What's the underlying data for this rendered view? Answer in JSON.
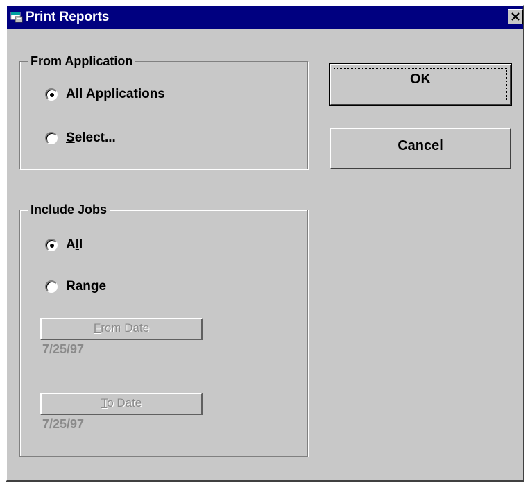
{
  "dialog": {
    "title": "Print Reports",
    "icon": "printer-window-icon",
    "close_icon": "close-x-icon"
  },
  "from_application": {
    "label": "From Application",
    "options": [
      {
        "first": "A",
        "rest": "ll Applications",
        "selected": true
      },
      {
        "first": "S",
        "rest": "elect...",
        "selected": false
      }
    ]
  },
  "include_jobs": {
    "label": "Include Jobs",
    "options": [
      {
        "pre": "A",
        "u": "l",
        "post": "l",
        "selected": true
      },
      {
        "pre": "",
        "u": "R",
        "post": "ange",
        "selected": false
      }
    ],
    "from_date": {
      "first": "F",
      "rest": "rom Date",
      "value": "7/25/97",
      "enabled": false
    },
    "to_date": {
      "first": "T",
      "rest": "o Date",
      "value": "7/25/97",
      "enabled": false
    }
  },
  "buttons": {
    "ok_label": "OK",
    "cancel_label": "Cancel"
  },
  "colors": {
    "titlebar": "#000080",
    "face": "#c8c8c8",
    "disabled_text": "#8a8a8a"
  }
}
